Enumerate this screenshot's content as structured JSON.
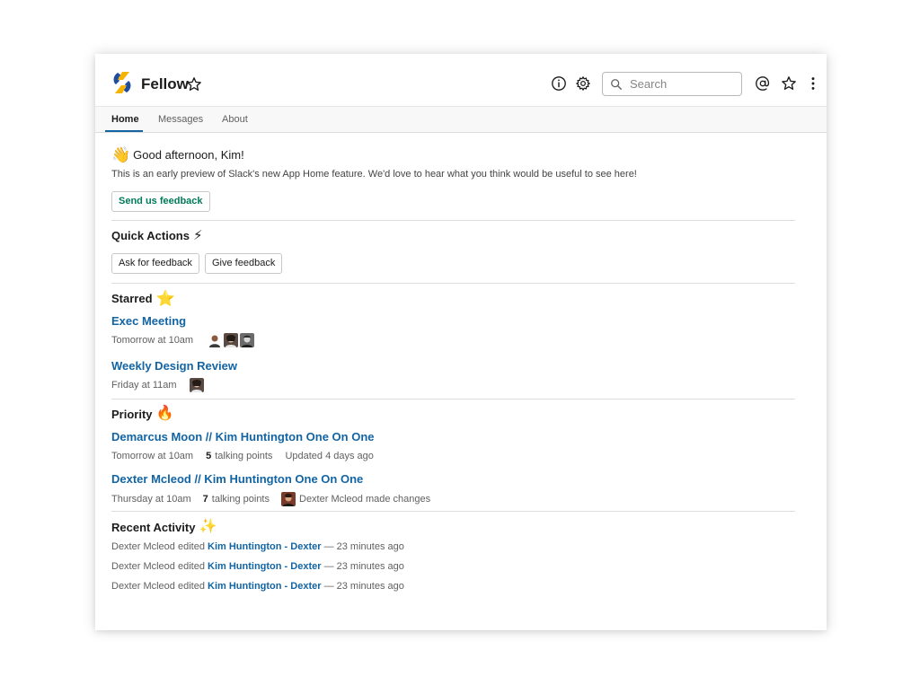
{
  "app": {
    "title": "Fellow"
  },
  "header": {
    "search_placeholder": "Search"
  },
  "tabs": [
    {
      "label": "Home",
      "active": true
    },
    {
      "label": "Messages",
      "active": false
    },
    {
      "label": "About",
      "active": false
    }
  ],
  "home": {
    "greeting_emoji": "👋",
    "greeting": "Good afternoon, Kim!",
    "intro": "This is an early preview of Slack's new App Home feature. We'd love to hear what you think would be useful to see here!",
    "feedback_button": "Send us feedback"
  },
  "quick_actions": {
    "title": "Quick Actions",
    "emoji": "⚡",
    "buttons": [
      "Ask for feedback",
      "Give feedback"
    ]
  },
  "starred": {
    "title": "Starred",
    "emoji": "⭐",
    "items": [
      {
        "title": "Exec Meeting",
        "time": "Tomorrow at 10am"
      },
      {
        "title": "Weekly Design Review",
        "time": "Friday at 11am"
      }
    ]
  },
  "priority": {
    "title": "Priority",
    "emoji": "🔥",
    "items": [
      {
        "title": "Demarcus Moon // Kim Huntington One On One",
        "time": "Tomorrow at 10am",
        "points_count": "5",
        "points_label": "talking points",
        "extra": "Updated 4 days ago"
      },
      {
        "title": "Dexter Mcleod // Kim Huntington One On One",
        "time": "Thursday at 10am",
        "points_count": "7",
        "points_label": "talking points",
        "extra": "Dexter Mcleod made changes"
      }
    ]
  },
  "recent_activity": {
    "title": "Recent Activity",
    "emoji": "✨",
    "items": [
      {
        "actor": "Dexter Mcleod edited",
        "link": "Kim Huntington - Dexter",
        "when": "— 23 minutes ago"
      },
      {
        "actor": "Dexter Mcleod edited",
        "link": "Kim Huntington - Dexter",
        "when": "— 23 minutes ago"
      },
      {
        "actor": "Dexter Mcleod edited",
        "link": "Kim Huntington - Dexter",
        "when": "— 23 minutes ago"
      }
    ]
  },
  "colors": {
    "link": "#1264a3",
    "feedback_green": "#007a5a",
    "tab_underline": "#1264a3",
    "logo_blue": "#1f4e9e",
    "logo_yellow": "#f5b400"
  }
}
